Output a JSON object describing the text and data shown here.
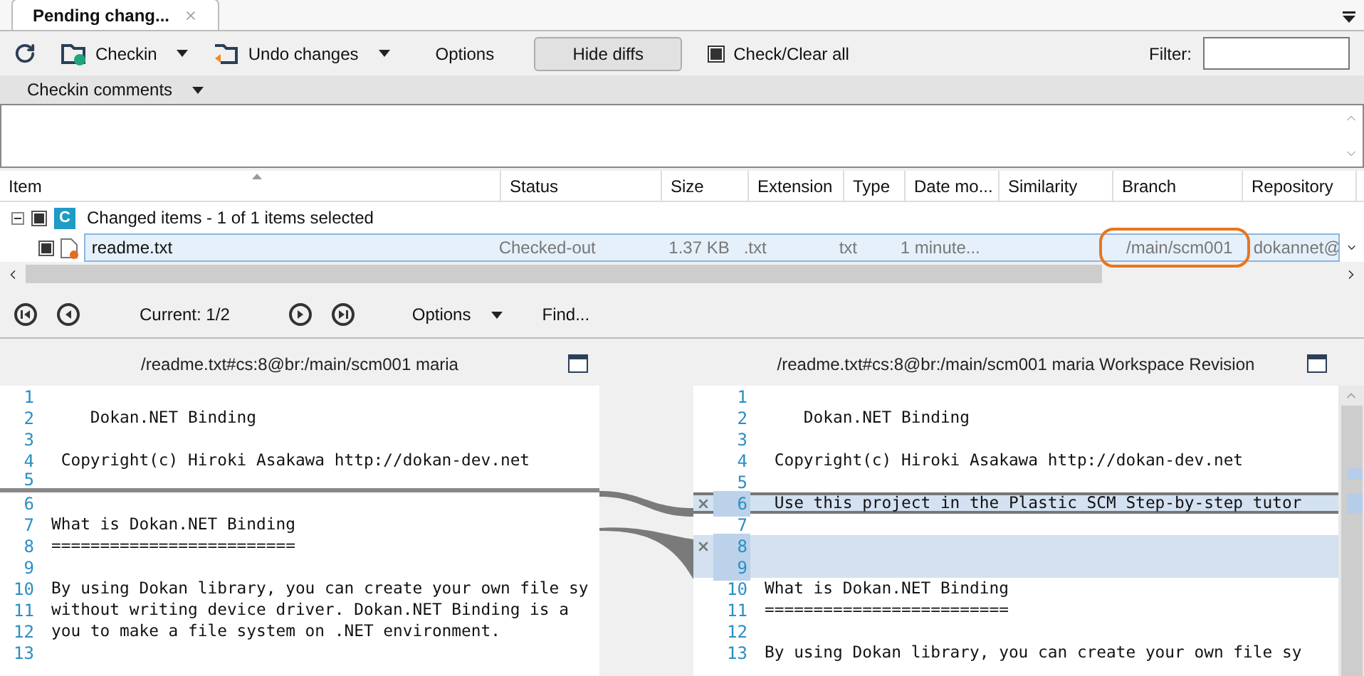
{
  "tab": {
    "title": "Pending chang...",
    "selected": true
  },
  "toolbar": {
    "checkin": "Checkin",
    "undo": "Undo changes",
    "options": "Options",
    "hide_diffs": "Hide diffs",
    "check_all": {
      "label": "Check/Clear all",
      "checked": true
    },
    "filter": {
      "label": "Filter:"
    }
  },
  "comments": {
    "title": "Checkin comments"
  },
  "table": {
    "columns": [
      "Item",
      "Status",
      "Size",
      "Extension",
      "Type",
      "Date mo...",
      "Similarity",
      "Branch",
      "Repository"
    ],
    "group": {
      "label": "Changed items - 1 of 1 items selected",
      "badge": "C",
      "expanded": true,
      "checked": true
    },
    "rows": [
      {
        "name": "readme.txt",
        "status": "Checked-out",
        "size": "1.37 KB",
        "extension": ".txt",
        "type": "txt",
        "date": "1 minute...",
        "branch": "/main/scm001",
        "repository": "dokannet@",
        "checked": true,
        "selected": true,
        "circled": true
      }
    ]
  },
  "navigator": {
    "current": "Current: 1/2",
    "options": "Options",
    "find": "Find..."
  },
  "left": {
    "title": "/readme.txt#cs:8@br:/main/scm001 maria",
    "lines": [
      {
        "n": "1",
        "kind": "normal"
      },
      {
        "n": "2",
        "text": "    Dokan.NET Binding",
        "kind": "normal"
      },
      {
        "n": "3",
        "kind": "normal"
      },
      {
        "n": "4",
        "text": " Copyright(c) Hiroki Asakawa http://dokan-dev.net",
        "kind": "normal"
      },
      {
        "n": "5",
        "kind": "gap"
      },
      {
        "n": "6",
        "kind": "normal"
      },
      {
        "n": "7",
        "text": "What is Dokan.NET Binding",
        "kind": "normal"
      },
      {
        "n": "8",
        "text": "=========================",
        "kind": "normal"
      },
      {
        "n": "9",
        "kind": "normal"
      },
      {
        "n": "10",
        "text": "By using Dokan library, you can create your own file sy",
        "kind": "normal"
      },
      {
        "n": "11",
        "text": "without writing device driver. Dokan.NET Binding is a",
        "kind": "normal"
      },
      {
        "n": "12",
        "text": "you to make a file system on .NET environment.",
        "kind": "normal"
      },
      {
        "n": "13",
        "kind": "normal"
      }
    ]
  },
  "right": {
    "title": "/readme.txt#cs:8@br:/main/scm001 maria Workspace Revision",
    "lines": [
      {
        "n": "1",
        "kind": "normal"
      },
      {
        "n": "2",
        "text": "    Dokan.NET Binding",
        "kind": "normal"
      },
      {
        "n": "3",
        "kind": "normal"
      },
      {
        "n": "4",
        "text": " Copyright(c) Hiroki Asakawa http://dokan-dev.net",
        "kind": "normal"
      },
      {
        "n": "5",
        "kind": "normal"
      },
      {
        "n": "6",
        "text": " Use this project in the Plastic SCM Step-by-step tutor",
        "kind": "changed"
      },
      {
        "n": "7",
        "kind": "normal"
      },
      {
        "n": "8",
        "kind": "added"
      },
      {
        "n": "9",
        "kind": "added"
      },
      {
        "n": "10",
        "text": "What is Dokan.NET Binding",
        "kind": "normal"
      },
      {
        "n": "11",
        "text": "=========================",
        "kind": "normal"
      },
      {
        "n": "12",
        "kind": "normal"
      },
      {
        "n": "13",
        "text": "By using Dokan library, you can create your own file sy",
        "kind": "normal"
      }
    ]
  }
}
